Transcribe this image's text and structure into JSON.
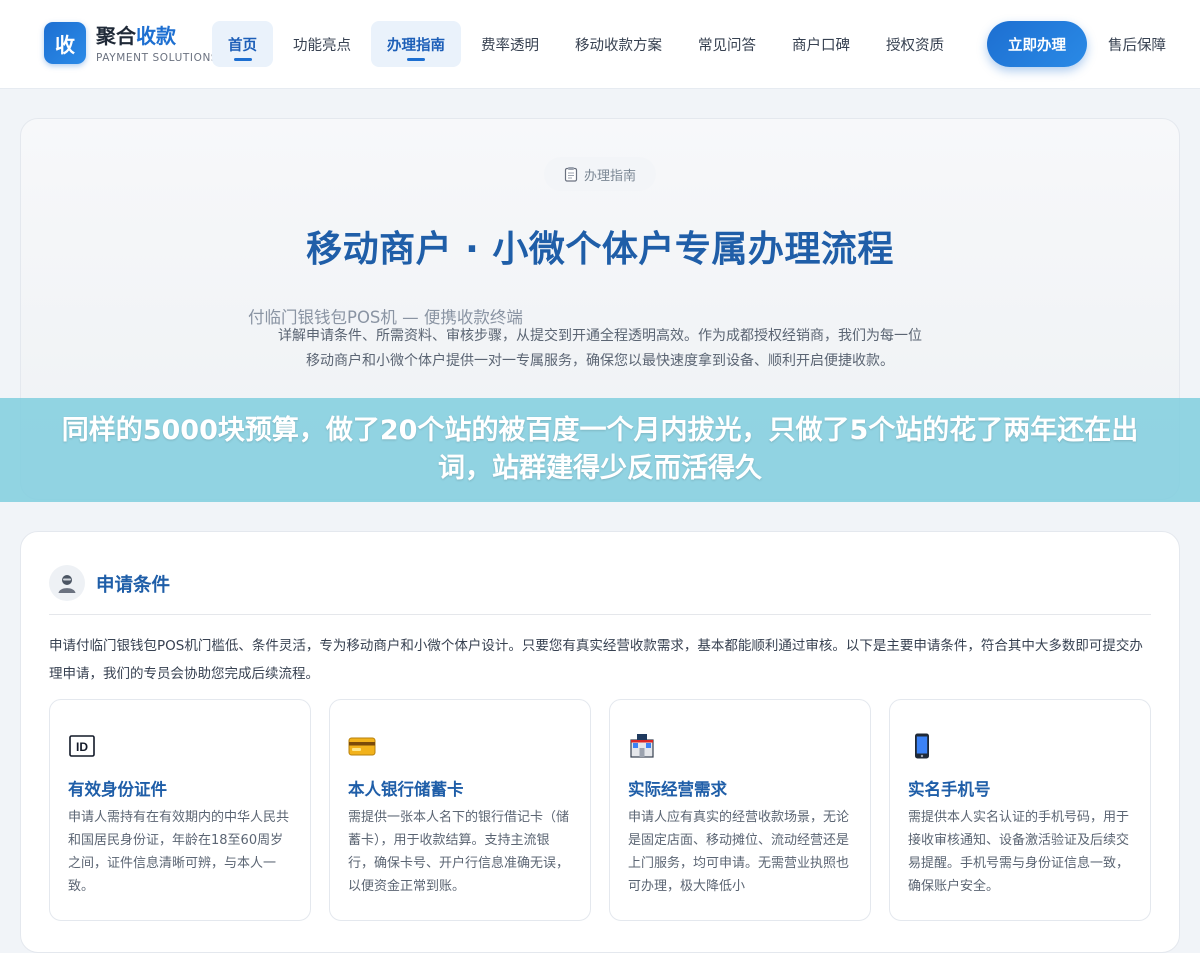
{
  "brand": {
    "logo_char": "收",
    "name_main": "聚合",
    "name_accent": "收款",
    "subtitle": "PAYMENT SOLUTIONS"
  },
  "nav": {
    "items": [
      {
        "label": "首页",
        "active": true
      },
      {
        "label": "功能亮点",
        "active": false
      },
      {
        "label": "办理指南",
        "active": true
      },
      {
        "label": "费率透明",
        "active": false
      },
      {
        "label": "移动收款方案",
        "active": false
      },
      {
        "label": "常见问答",
        "active": false
      },
      {
        "label": "商户口碑",
        "active": false
      },
      {
        "label": "授权资质",
        "active": false
      }
    ],
    "cta_label": "立即办理",
    "after_sales_label": "售后保障"
  },
  "hero": {
    "pill_label": "办理指南",
    "title": "移动商户 · 小微个体户专属办理流程",
    "subtitle": "付临门银钱包POS机 — 便携收款终端",
    "description": "详解申请条件、所需资料、审核步骤，从提交到开通全程透明高效。作为成都授权经销商，我们为每一位移动商户和小微个体户提供一对一专属服务，确保您以最快速度拿到设备、顺利开启便捷收款。"
  },
  "banner": {
    "text": "同样的5000块预算，做了20个站的被百度一个月内拔光，只做了5个站的花了两年还在出词，站群建得少反而活得久"
  },
  "section": {
    "title": "申请条件",
    "intro": "申请付临门银钱包POS机门槛低、条件灵活，专为移动商户和小微个体户设计。只要您有真实经营收款需求，基本都能顺利通过审核。以下是主要申请条件，符合其中大多数即可提交办理申请，我们的专员会协助您完成后续流程。",
    "cards": [
      {
        "icon": "id-card-icon",
        "title": "有效身份证件",
        "desc": "申请人需持有在有效期内的中华人民共和国居民身份证，年龄在18至60周岁之间，证件信息清晰可辨，与本人一致。"
      },
      {
        "icon": "bank-card-icon",
        "title": "本人银行储蓄卡",
        "desc": "需提供一张本人名下的银行借记卡（储蓄卡），用于收款结算。支持主流银行，确保卡号、开户行信息准确无误，以便资金正常到账。"
      },
      {
        "icon": "storefront-icon",
        "title": "实际经营需求",
        "desc": "申请人应有真实的经营收款场景，无论是固定店面、移动摊位、流动经营还是上门服务，均可申请。无需营业执照也可办理，极大降低小"
      },
      {
        "icon": "mobile-phone-icon",
        "title": "实名手机号",
        "desc": "需提供本人实名认证的手机号码，用于接收审核通知、设备激活验证及后续交易提醒。手机号需与身份证信息一致，确保账户安全。"
      }
    ]
  }
}
